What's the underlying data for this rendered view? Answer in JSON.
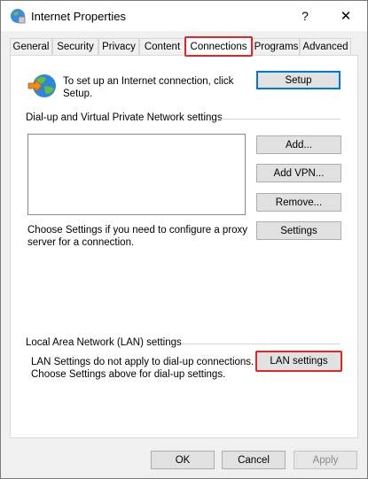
{
  "window": {
    "title": "Internet Properties",
    "help_glyph": "?",
    "close_glyph": "✕"
  },
  "tabs": [
    {
      "label": "General"
    },
    {
      "label": "Security"
    },
    {
      "label": "Privacy"
    },
    {
      "label": "Content"
    },
    {
      "label": "Connections",
      "active": true
    },
    {
      "label": "Programs"
    },
    {
      "label": "Advanced"
    }
  ],
  "setup": {
    "description": "To set up an Internet connection, click Setup.",
    "button_label": "Setup"
  },
  "dialup": {
    "section_title": "Dial-up and Virtual Private Network settings",
    "add_label": "Add...",
    "add_vpn_label": "Add VPN...",
    "remove_label": "Remove...",
    "proxy_text": "Choose Settings if you need to configure a proxy server for a connection.",
    "settings_label": "Settings"
  },
  "lan": {
    "section_title": "Local Area Network (LAN) settings",
    "description": "LAN Settings do not apply to dial-up connections. Choose Settings above for dial-up settings.",
    "button_label": "LAN settings"
  },
  "footer": {
    "ok_label": "OK",
    "cancel_label": "Cancel",
    "apply_label": "Apply"
  },
  "colors": {
    "highlight": "#e0262b",
    "focus": "#0078d7"
  }
}
